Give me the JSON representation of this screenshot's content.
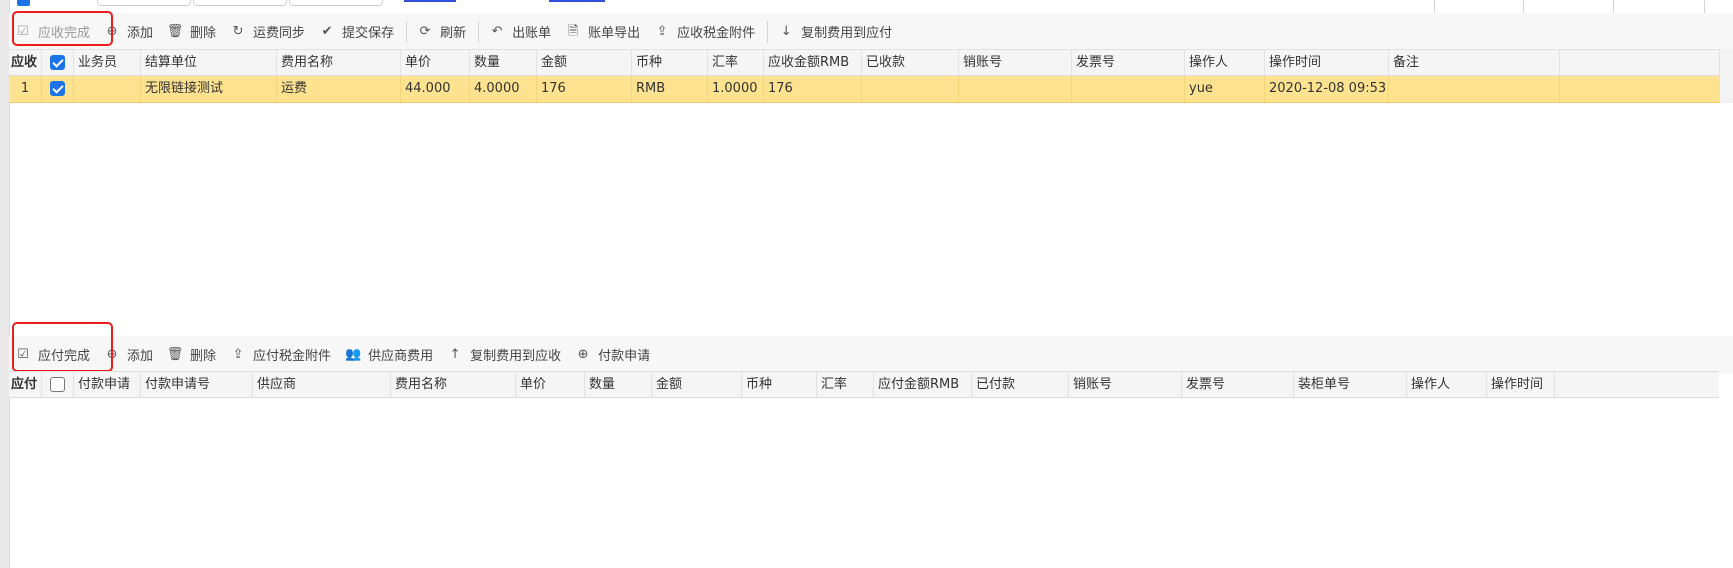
{
  "receivable": {
    "toolbar": [
      {
        "name": "complete-receivable-button",
        "icon": "check-square-icon",
        "glyph": "☑",
        "label": "应收完成",
        "disabled": true
      },
      {
        "name": "add-receivable-button",
        "icon": "plus-circle-icon",
        "glyph": "⊕",
        "label": "添加"
      },
      {
        "name": "delete-receivable-button",
        "icon": "trash-icon",
        "glyph": "🗑",
        "label": "删除"
      },
      {
        "name": "freight-sync-button",
        "icon": "sync-icon",
        "glyph": "↻",
        "label": "运费同步"
      },
      {
        "name": "submit-save-button",
        "icon": "checkmark-icon",
        "glyph": "✔",
        "label": "提交保存"
      },
      {
        "sep": true
      },
      {
        "name": "refresh-button",
        "icon": "refresh-icon",
        "glyph": "⟳",
        "label": "刷新"
      },
      {
        "sep": true
      },
      {
        "name": "create-bill-button",
        "icon": "reply-icon",
        "glyph": "↶",
        "label": "出账单"
      },
      {
        "name": "export-bill-button",
        "icon": "document-icon",
        "glyph": "🗎",
        "label": "账单导出"
      },
      {
        "name": "receivable-tax-attachment-button",
        "icon": "upload-icon",
        "glyph": "⇪",
        "label": "应收税金附件"
      },
      {
        "sep": true
      },
      {
        "name": "copy-to-payable-button",
        "icon": "arrow-down-icon",
        "glyph": "↓",
        "label": "复制费用到应付"
      }
    ],
    "tag": "应收",
    "headers": [
      "业务员",
      "结算单位",
      "费用名称",
      "单价",
      "数量",
      "金额",
      "币种",
      "汇率",
      "应收金额RMB",
      "已收款",
      "销账号",
      "发票号",
      "操作人",
      "操作时间",
      "备注"
    ],
    "rows": [
      {
        "index": "1",
        "checked": true,
        "cells": [
          "",
          "无限链接测试",
          "运费",
          "44.000",
          "4.0000",
          "176",
          "RMB",
          "1.0000",
          "176",
          "",
          "",
          "",
          "yue",
          "2020-12-08 09:53",
          ""
        ]
      }
    ]
  },
  "payable": {
    "toolbar": [
      {
        "name": "complete-payable-button",
        "icon": "check-square-icon",
        "glyph": "☑",
        "label": "应付完成"
      },
      {
        "name": "add-payable-button",
        "icon": "plus-circle-icon",
        "glyph": "⊕",
        "label": "添加"
      },
      {
        "name": "delete-payable-button",
        "icon": "trash-icon",
        "glyph": "🗑",
        "label": "删除"
      },
      {
        "name": "payable-tax-attachment-button",
        "icon": "upload-icon",
        "glyph": "⇪",
        "label": "应付税金附件"
      },
      {
        "name": "supplier-fees-button",
        "icon": "users-icon",
        "glyph": "👥",
        "label": "供应商费用"
      },
      {
        "name": "copy-to-receivable-button",
        "icon": "arrow-up-icon",
        "glyph": "↑",
        "label": "复制费用到应收"
      },
      {
        "name": "payment-request-button",
        "icon": "plus-circle-icon",
        "glyph": "⊕",
        "label": "付款申请"
      }
    ],
    "tag": "应付",
    "headers": [
      "付款申请",
      "付款申请号",
      "供应商",
      "费用名称",
      "单价",
      "数量",
      "金额",
      "币种",
      "汇率",
      "应付金额RMB",
      "已付款",
      "销账号",
      "发票号",
      "装柜单号",
      "操作人",
      "操作时间"
    ],
    "rows": []
  }
}
